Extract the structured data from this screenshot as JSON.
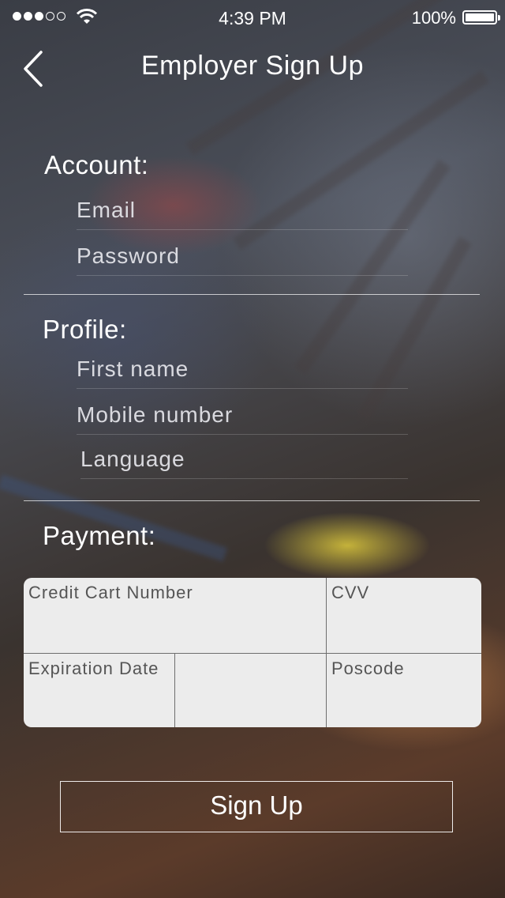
{
  "status_bar": {
    "time": "4:39 PM",
    "battery_percent": "100%",
    "signal_bars_filled": 3,
    "signal_bars_total": 5
  },
  "header": {
    "back_icon": "chevron-left-icon",
    "title": "Employer Sign Up"
  },
  "account": {
    "heading": "Account:",
    "email_placeholder": "Email",
    "password_placeholder": "Password"
  },
  "profile": {
    "heading": "Profile:",
    "first_name_placeholder": "First name",
    "mobile_placeholder": "Mobile number",
    "language_placeholder": "Language"
  },
  "payment": {
    "heading": "Payment:",
    "card_number_placeholder": "Credit Cart Number",
    "cvv_placeholder": "CVV",
    "expiration_placeholder": "Expiration Date",
    "poscode_placeholder": "Poscode"
  },
  "actions": {
    "signup_label": "Sign Up"
  },
  "colors": {
    "text": "#ffffff",
    "payment_box": "#ececec",
    "payment_text": "#555555"
  }
}
